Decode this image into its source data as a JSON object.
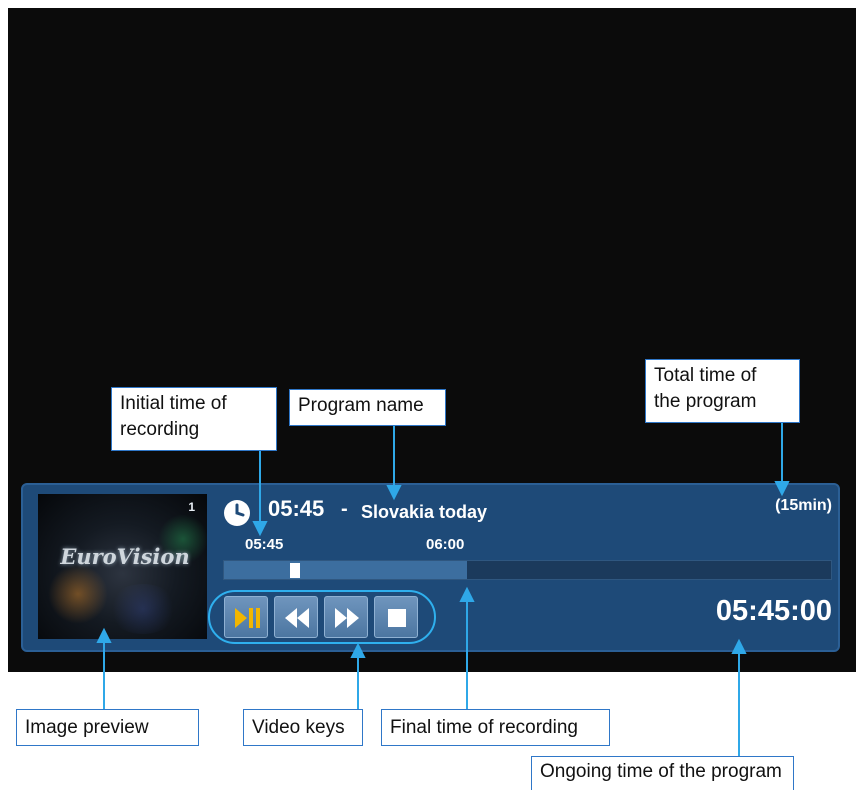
{
  "osd": {
    "start_time": "05:45",
    "separator": "-",
    "program_name": "Slovakia today",
    "duration": "(15min)",
    "tick_start": "05:45",
    "tick_end": "06:00",
    "elapsed": "05:45:00",
    "progress_fraction": 0.4,
    "playhead_fraction": 0.11
  },
  "preview": {
    "logo_text": "EuroVision",
    "channel_number": "1"
  },
  "video_keys": [
    {
      "name": "play-pause-icon",
      "color": "#f2b600"
    },
    {
      "name": "rewind-icon",
      "color": "#ffffff"
    },
    {
      "name": "fast-forward-icon",
      "color": "#ffffff"
    },
    {
      "name": "stop-icon",
      "color": "#ffffff"
    }
  ],
  "callouts": {
    "initial_time": [
      "Initial time of",
      "recording"
    ],
    "program_name": "Program name",
    "total_time": [
      "Total time of",
      "the program"
    ],
    "image_preview": "Image preview",
    "video_keys": "Video keys",
    "final_time": "Final time of recording",
    "ongoing_time": "Ongoing time of the program"
  },
  "colors": {
    "osd_background": "#1e4a78",
    "arrow": "#2fa8e8",
    "keys_frame": "#2fb0ee"
  }
}
